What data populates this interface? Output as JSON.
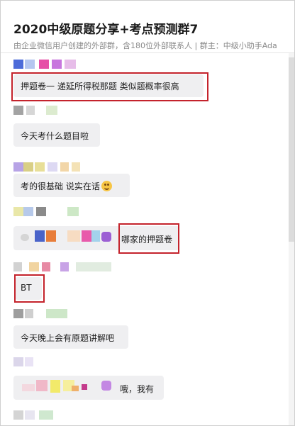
{
  "header": {
    "title": "2020中级原题分享+考点预测群7",
    "subtitle": "由企业微信用户创建的外部群，含180位外部联系人 | 群主：中级小助手Ada"
  },
  "messages": [
    {
      "text": "押题卷一  递延所得税那题 类似题概率很高"
    },
    {
      "text": "今天考什么题目啦"
    },
    {
      "text": "考的很基础 说实在话"
    },
    {
      "text": "哪家的押题卷"
    },
    {
      "text": "BT"
    },
    {
      "text": "今天晚上会有原题讲解吧"
    },
    {
      "text": "哦，我有"
    }
  ],
  "colors": {
    "bubble": "#efeff1",
    "highlight": "#c4232c",
    "muted": "#8a8a8a"
  }
}
